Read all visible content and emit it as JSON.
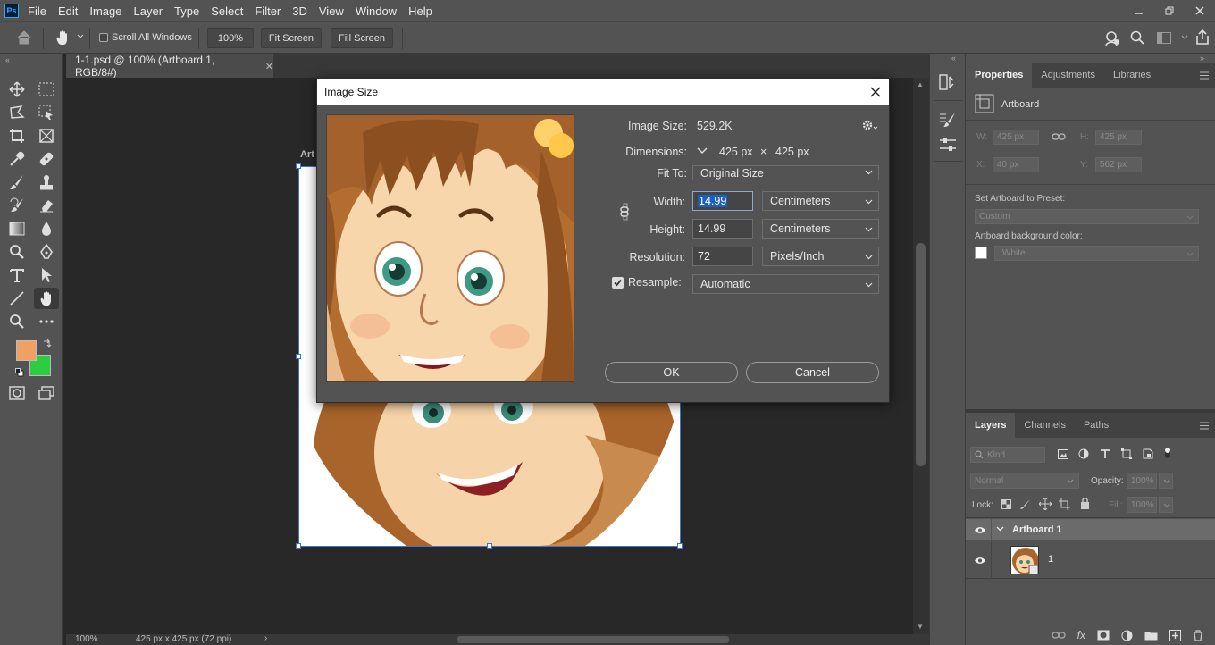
{
  "app": {
    "logo": "Ps",
    "menu": [
      "File",
      "Edit",
      "Image",
      "Layer",
      "Type",
      "Select",
      "Filter",
      "3D",
      "View",
      "Window",
      "Help"
    ],
    "window_controls": [
      "minimize-icon",
      "restore-icon",
      "close-icon"
    ]
  },
  "options_bar": {
    "scroll_all_windows": "Scroll All Windows",
    "scroll_all_checked": false,
    "zoom_value": "100%",
    "fit_screen": "Fit Screen",
    "fill_screen": "Fill Screen"
  },
  "document": {
    "tab_title": "1-1.psd @ 100% (Artboard 1, RGB/8#)",
    "artboard_label": "Art",
    "status_zoom": "100%",
    "status_info": "425 px x 425 px (72 ppi)"
  },
  "tools": {
    "foreground_color": "#F0A060",
    "background_color": "#2ECC40"
  },
  "properties_panel": {
    "tabs": [
      "Properties",
      "Adjustments",
      "Libraries"
    ],
    "active_tab": "Properties",
    "artboard_title": "Artboard",
    "w_label": "W:",
    "w_value": "425 px",
    "h_label": "H:",
    "h_value": "425 px",
    "x_label": "X:",
    "x_value": "40 px",
    "y_label": "Y:",
    "y_value": "562 px",
    "preset_label": "Set Artboard to Preset:",
    "preset_value": "Custom",
    "bg_label": "Artboard background color:",
    "bg_value": "White"
  },
  "layers_panel": {
    "tabs": [
      "Layers",
      "Channels",
      "Paths"
    ],
    "active_tab": "Layers",
    "kind_placeholder": "Kind",
    "blend_mode": "Normal",
    "opacity_label": "Opacity:",
    "opacity_value": "100%",
    "lock_label": "Lock:",
    "fill_label": "Fill:",
    "fill_value": "100%",
    "layers": [
      {
        "name": "Artboard 1",
        "type": "artboard"
      },
      {
        "name": "1",
        "type": "smart-object"
      }
    ]
  },
  "dialog": {
    "title": "Image Size",
    "image_size_label": "Image Size:",
    "image_size_value": "529.2K",
    "dimensions_label": "Dimensions:",
    "dim_width": "425 px",
    "dim_times": "×",
    "dim_height": "425 px",
    "fit_to_label": "Fit To:",
    "fit_to_value": "Original Size",
    "width_label": "Width:",
    "width_value": "14.99",
    "width_unit": "Centimeters",
    "height_label": "Height:",
    "height_value": "14.99",
    "height_unit": "Centimeters",
    "resolution_label": "Resolution:",
    "resolution_value": "72",
    "resolution_unit": "Pixels/Inch",
    "resample_label": "Resample:",
    "resample_checked": true,
    "resample_value": "Automatic",
    "ok_label": "OK",
    "cancel_label": "Cancel"
  }
}
